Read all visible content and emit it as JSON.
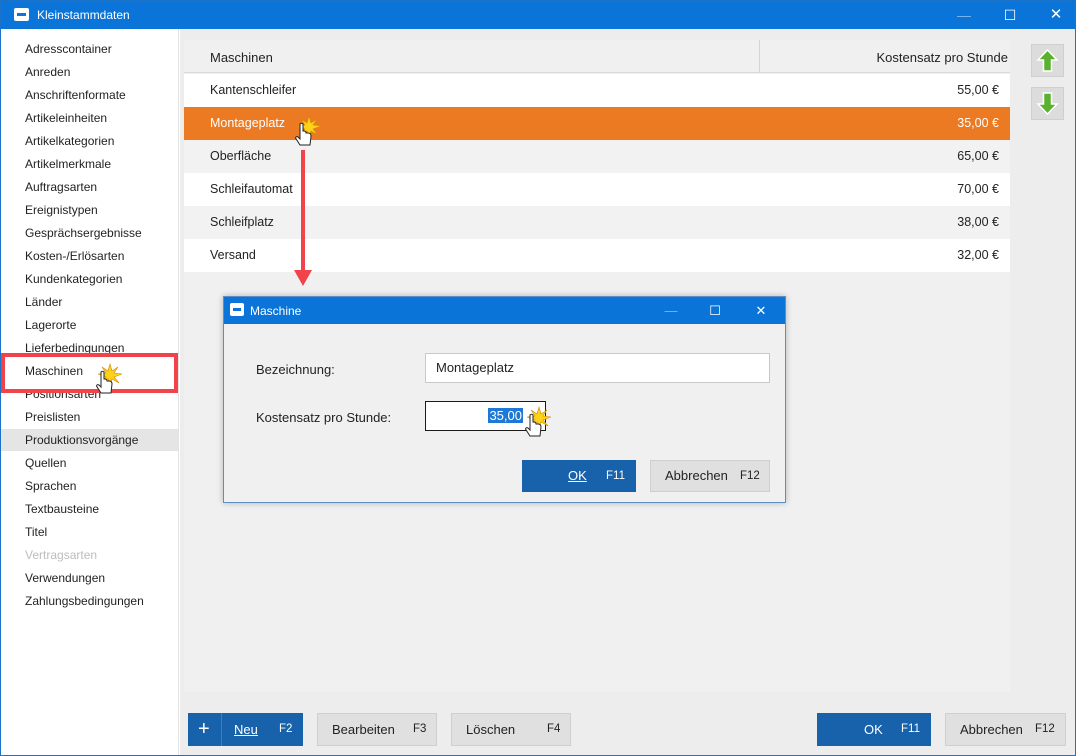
{
  "window": {
    "title": "Kleinstammdaten",
    "controls": {
      "minimize": "—",
      "maximize": "☐",
      "close": "✕"
    }
  },
  "sidebar": {
    "items": [
      {
        "label": "Adresscontainer",
        "state": "normal"
      },
      {
        "label": "Anreden",
        "state": "normal"
      },
      {
        "label": "Anschriftenformate",
        "state": "normal"
      },
      {
        "label": "Artikeleinheiten",
        "state": "normal"
      },
      {
        "label": "Artikelkategorien",
        "state": "normal"
      },
      {
        "label": "Artikelmerkmale",
        "state": "normal"
      },
      {
        "label": "Auftragsarten",
        "state": "normal"
      },
      {
        "label": "Ereignistypen",
        "state": "normal"
      },
      {
        "label": "Gesprächsergebnisse",
        "state": "normal"
      },
      {
        "label": "Kosten-/Erlösarten",
        "state": "normal"
      },
      {
        "label": "Kundenkategorien",
        "state": "normal"
      },
      {
        "label": "Länder",
        "state": "normal"
      },
      {
        "label": "Lagerorte",
        "state": "normal"
      },
      {
        "label": "Lieferbedingungen",
        "state": "normal"
      },
      {
        "label": "Maschinen",
        "state": "highlighted"
      },
      {
        "label": "Positionsarten",
        "state": "normal"
      },
      {
        "label": "Preislisten",
        "state": "normal"
      },
      {
        "label": "Produktionsvorgänge",
        "state": "selected"
      },
      {
        "label": "Quellen",
        "state": "normal"
      },
      {
        "label": "Sprachen",
        "state": "normal"
      },
      {
        "label": "Textbausteine",
        "state": "normal"
      },
      {
        "label": "Titel",
        "state": "normal"
      },
      {
        "label": "Vertragsarten",
        "state": "disabled"
      },
      {
        "label": "Verwendungen",
        "state": "normal"
      },
      {
        "label": "Zahlungsbedingungen",
        "state": "normal"
      }
    ]
  },
  "table": {
    "columns": [
      "Maschinen",
      "Kostensatz pro Stunde"
    ],
    "rows": [
      {
        "name": "Kantenschleifer",
        "rate": "55,00 €"
      },
      {
        "name": "Montageplatz",
        "rate": "35,00 €",
        "selected": true
      },
      {
        "name": "Oberfläche",
        "rate": "65,00 €"
      },
      {
        "name": "Schleifautomat",
        "rate": "70,00 €"
      },
      {
        "name": "Schleifplatz",
        "rate": "38,00 €"
      },
      {
        "name": "Versand",
        "rate": "32,00 €"
      }
    ]
  },
  "side_buttons": {
    "up_icon": "arrow-up-icon",
    "down_icon": "arrow-down-icon",
    "accent": "#5ab02f"
  },
  "dialog": {
    "title": "Maschine",
    "bezeichnung_label": "Bezeichnung:",
    "bezeichnung_value": "Montageplatz",
    "kostensatz_label": "Kostensatz pro Stunde:",
    "kostensatz_value": "35,00",
    "ok_label": "OK",
    "ok_key": "F11",
    "cancel_label": "Abbrechen",
    "cancel_key": "F12"
  },
  "toolbar": {
    "neu_label": "Neu",
    "neu_key": "F2",
    "bearbeiten_label": "Bearbeiten",
    "bearbeiten_key": "F3",
    "loeschen_label": "Löschen",
    "loeschen_key": "F4",
    "ok_label": "OK",
    "ok_key": "F11",
    "abbrechen_label": "Abbrechen",
    "abbrechen_key": "F12"
  },
  "colors": {
    "titlebar": "#0a74d9",
    "selection": "#ec7a22",
    "primary_button": "#1862ab",
    "annotation_red": "#f0434a"
  }
}
